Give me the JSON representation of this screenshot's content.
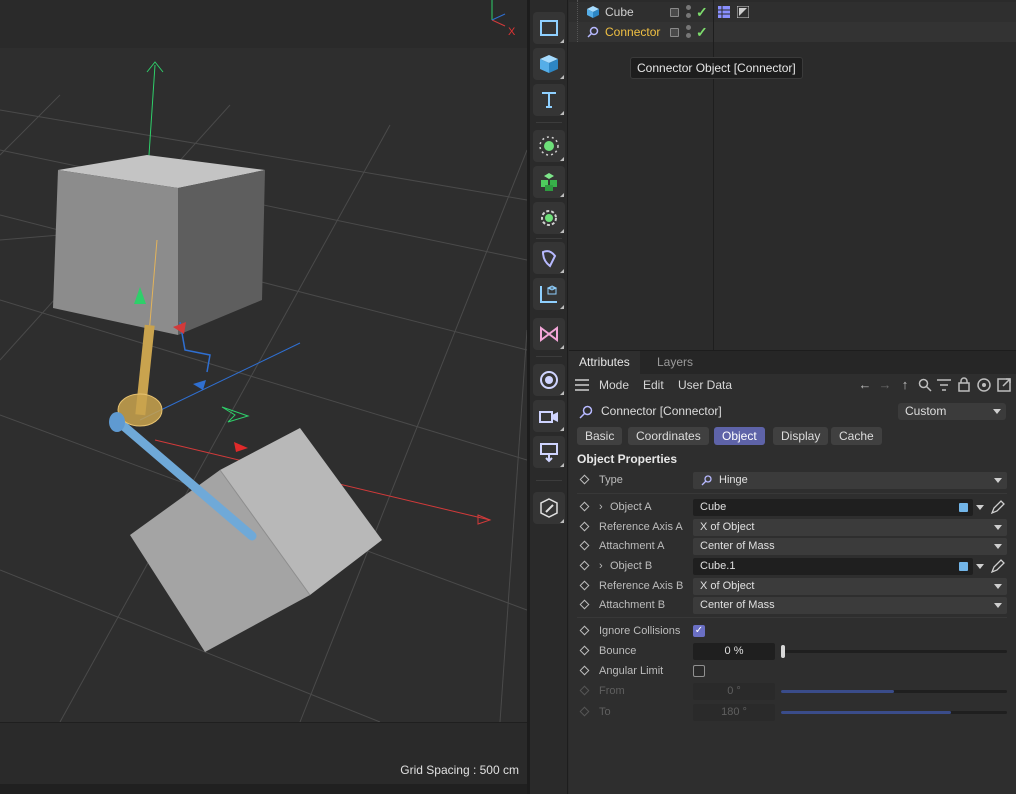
{
  "viewport": {
    "grid_spacing": "Grid Spacing : 500 cm",
    "axis_gizmo_x": "X"
  },
  "toolbar": {
    "tools": [
      "rectangle-spline-tool",
      "cube-primitive-tool",
      "text-tool",
      "light-tool",
      "cloner-tool",
      "effector-tool",
      "deformer-tool",
      "hierarchy-tool",
      "tag-tool",
      "environment-tool",
      "camera-tool",
      "render-tool",
      "edit-tool"
    ]
  },
  "object_manager": {
    "rows": [
      {
        "name": "Cube",
        "icon": "cube-icon",
        "color": "#cfcfcf"
      },
      {
        "name": "Connector",
        "icon": "connector-icon",
        "color": "#f0c043"
      }
    ],
    "tooltip": "Connector Object [Connector]"
  },
  "attributes": {
    "tabs": [
      "Attributes",
      "Layers"
    ],
    "menu": [
      "Mode",
      "Edit",
      "User Data"
    ],
    "object_title": "Connector [Connector]",
    "preset": "Custom",
    "subtabs": [
      "Basic",
      "Coordinates",
      "Object",
      "Display",
      "Cache"
    ],
    "active_subtab": "Object",
    "section_title": "Object Properties",
    "props": {
      "type": {
        "label": "Type",
        "value": "Hinge"
      },
      "object_a": {
        "label": "Object A",
        "value": "Cube"
      },
      "ref_axis_a": {
        "label": "Reference Axis A",
        "value": "X of Object"
      },
      "attach_a": {
        "label": "Attachment A",
        "value": "Center of Mass"
      },
      "object_b": {
        "label": "Object B",
        "value": "Cube.1"
      },
      "ref_axis_b": {
        "label": "Reference Axis B",
        "value": "X of Object"
      },
      "attach_b": {
        "label": "Attachment B",
        "value": "Center of Mass"
      },
      "ignore_collisions": {
        "label": "Ignore Collisions",
        "checked": true
      },
      "bounce": {
        "label": "Bounce",
        "value": "0 %",
        "level": 0
      },
      "angular_limit": {
        "label": "Angular Limit",
        "checked": false
      },
      "from": {
        "label": "From",
        "value": "0 °",
        "level": 0.5
      },
      "to": {
        "label": "To",
        "value": "180 °",
        "level": 0.75
      }
    }
  }
}
